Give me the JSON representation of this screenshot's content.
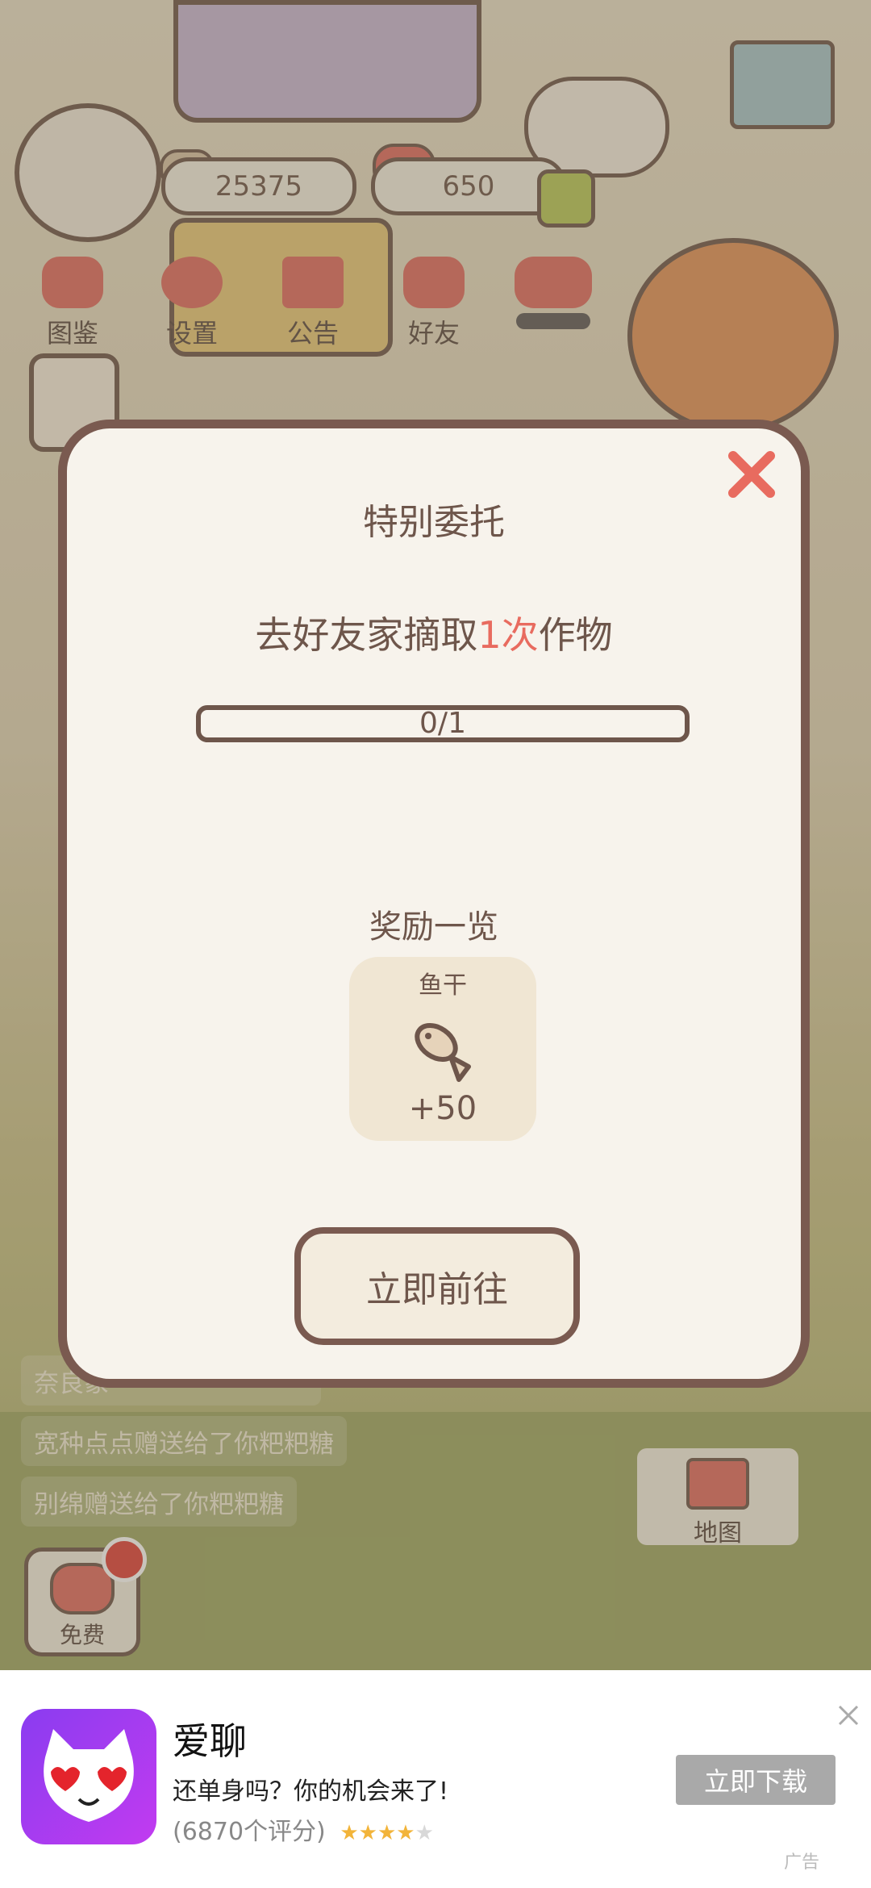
{
  "hud": {
    "fish_count": "25375",
    "heart_count": "650"
  },
  "nav": [
    {
      "label": "图鉴",
      "icon": "cat-book-icon"
    },
    {
      "label": "设置",
      "icon": "gear-icon"
    },
    {
      "label": "公告",
      "icon": "gift-icon"
    },
    {
      "label": "好友",
      "icon": "friends-icon"
    }
  ],
  "chat": {
    "line1": "奈良象",
    "line2": "宽种点点赠送给了你粑粑糖",
    "line3": "别绵赠送给了你粑粑糖"
  },
  "map_label": "地图",
  "free_label": "免费",
  "modal": {
    "title": "特别委托",
    "task_prefix": "去好友家摘取",
    "task_highlight": "1次",
    "task_suffix": "作物",
    "progress_text": "0/1",
    "progress_fraction": 0,
    "reward_heading": "奖励一览",
    "reward_name": "鱼干",
    "reward_qty": "+50",
    "go_button": "立即前往"
  },
  "ad": {
    "title": "爱聊",
    "desc": "还单身吗？你的机会来了!",
    "rating": "(6870个评分)",
    "stars": 4,
    "button": "立即下载",
    "tag": "广告"
  },
  "colors": {
    "accent": "#e86b5f",
    "frame": "#7a5a50",
    "text": "#6e564b"
  }
}
